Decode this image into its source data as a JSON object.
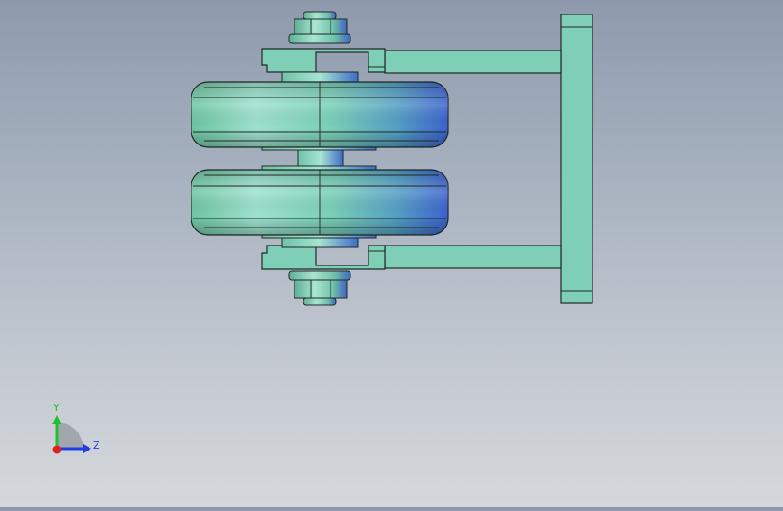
{
  "viewport": {
    "background": "gradient-grey",
    "model_colors": {
      "part": "#7fcfb6",
      "edge": "#1f2b26",
      "highlight": "#aee9d8",
      "blue": "#4a78d4"
    }
  },
  "triad": {
    "y_label": "Y",
    "z_label": "Z",
    "y_color": "#22c02a",
    "z_color": "#1f3fe0",
    "x_color": "#e02020"
  }
}
